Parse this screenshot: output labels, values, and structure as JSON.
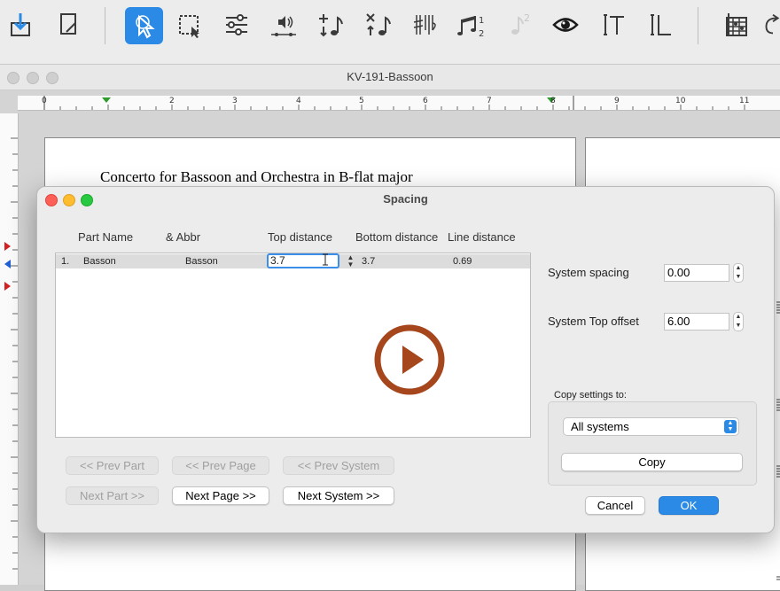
{
  "toolbar": {
    "icons": [
      "download-icon",
      "edit-page-icon",
      "pointer-select-icon",
      "marquee-select-icon",
      "sliders-icon",
      "playback-note-icon",
      "add-note-icon",
      "remove-note-icon",
      "accidentals-icon",
      "tuplet-icon",
      "grace-note-icon",
      "eye-icon",
      "text-tool-icon",
      "lyrics-tool-icon",
      "chord-grid-icon",
      "undo-icon"
    ],
    "grace_number": "2"
  },
  "document": {
    "window_title": "KV-191-Bassoon",
    "score_title": "Concerto for Bassoon and Orchestra in B-flat major",
    "ruler_h": [
      "0",
      "1",
      "2",
      "3",
      "4",
      "5",
      "6",
      "7",
      "8",
      "9",
      "10",
      "11"
    ],
    "ruler_v": [
      "1",
      "2",
      "3",
      "4",
      "5",
      "6"
    ]
  },
  "dialog": {
    "title": "Spacing",
    "columns": {
      "part_name": "Part Name",
      "abbr": "&  Abbr",
      "top_distance": "Top distance",
      "bottom_distance": "Bottom distance",
      "line_distance": "Line distance"
    },
    "rows": [
      {
        "index": "1.",
        "part_name": "Basson",
        "abbr": "Basson",
        "top_distance": "3.7",
        "bottom_distance": "3.7",
        "line_distance": "0.69"
      }
    ],
    "system_spacing_label": "System spacing",
    "system_spacing_value": "0.00",
    "system_top_offset_label": "System Top offset",
    "system_top_offset_value": "6.00",
    "copy_settings_label": "Copy settings to:",
    "copy_target": "All systems",
    "copy_button": "Copy",
    "prev_part": "<< Prev Part",
    "prev_page": "<< Prev Page",
    "prev_system": "<< Prev System",
    "next_part": "Next Part >>",
    "next_page": "Next Page >>",
    "next_system": "Next System >>",
    "cancel": "Cancel",
    "ok": "OK"
  },
  "colors": {
    "accent": "#2a8ae6",
    "play_overlay": "#a5461c"
  }
}
